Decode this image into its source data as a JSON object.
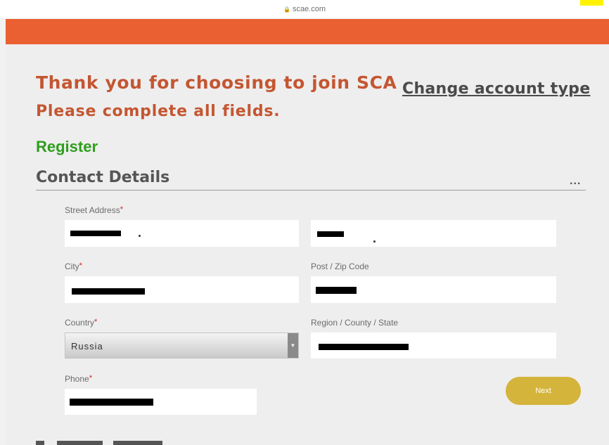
{
  "browser": {
    "url": "scae.com",
    "lock_icon": "lock-icon"
  },
  "header": {
    "color": "#ea6033"
  },
  "main": {
    "thanks_text": "Thank you for choosing to join SCA",
    "instruction_text": "Please complete all fields.",
    "change_account_link": "Change account type",
    "register_heading": "Register",
    "section_title": "Contact Details",
    "more_label": "..."
  },
  "form": {
    "street_address": {
      "label": "Street Address",
      "required": "*"
    },
    "city": {
      "label": "City",
      "required": "*"
    },
    "post_zip": {
      "label": "Post / Zip Code"
    },
    "country": {
      "label": "Country",
      "required": "*",
      "value": "Russia"
    },
    "region": {
      "label": "Region / County / State"
    },
    "phone": {
      "label": "Phone",
      "required": "*"
    },
    "next_button": "Next"
  },
  "colors": {
    "accent": "#ea6033",
    "heading": "#c45631",
    "register": "#2e9e1c",
    "button": "#d4b43a",
    "required": "#d02020"
  }
}
